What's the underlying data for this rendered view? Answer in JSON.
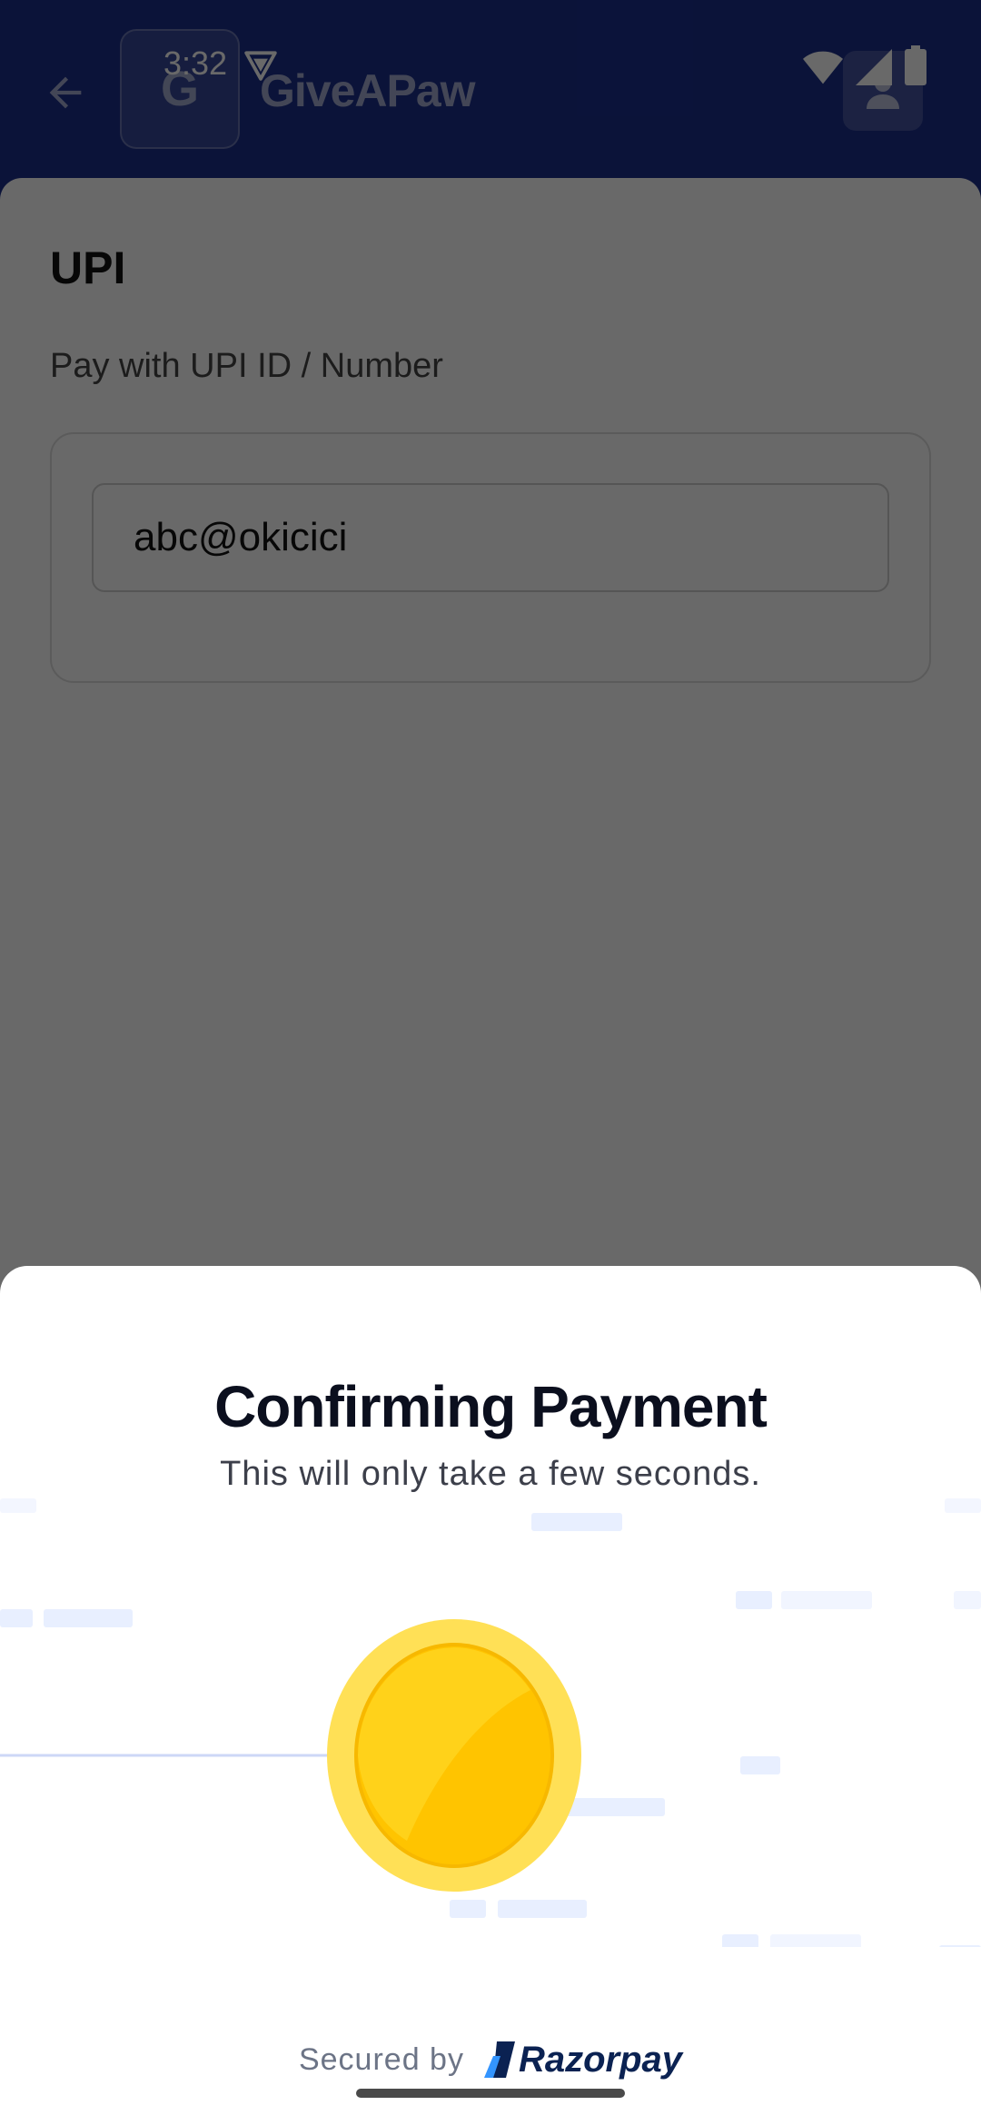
{
  "status_bar": {
    "time": "3:32"
  },
  "header": {
    "logo_letter": "G",
    "brand_name": "GiveAPaw"
  },
  "upi": {
    "title": "UPI",
    "subtitle": "Pay with UPI ID / Number",
    "input_value": "abc@okicici"
  },
  "sheet": {
    "title": "Confirming Payment",
    "subtitle": "This will only take a few seconds.",
    "secured_label": "Secured by",
    "brand": "Razorpay"
  },
  "colors": {
    "header_bg": "#1b2e8c",
    "coin_gold": "#ffc400",
    "razorpay_navy": "#0b2252",
    "razorpay_blue": "#3395ff"
  },
  "icons": [
    "back-arrow-icon",
    "vpn-icon",
    "wifi-icon",
    "cell-signal-icon",
    "battery-icon",
    "account-icon",
    "coin-icon",
    "razorpay-logo-icon"
  ]
}
